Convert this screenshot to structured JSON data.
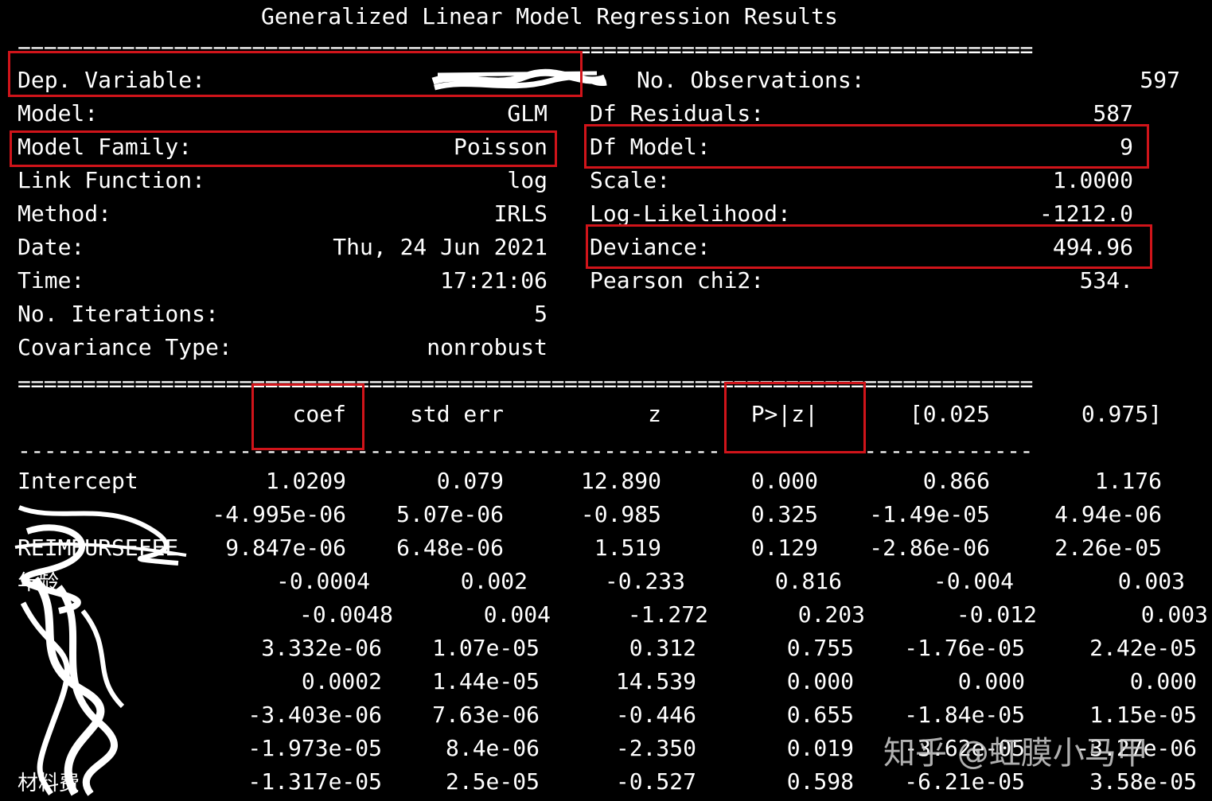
{
  "title": "Generalized Linear Model Regression Results",
  "rules": {
    "eq": "==============================================================================",
    "dash": "------------------------------------------------------------------------------"
  },
  "left": [
    {
      "label": "Dep. Variable:",
      "value": ""
    },
    {
      "label": "Model:",
      "value": "GLM"
    },
    {
      "label": "Model Family:",
      "value": "Poisson"
    },
    {
      "label": "Link Function:",
      "value": "log"
    },
    {
      "label": "Method:",
      "value": "IRLS"
    },
    {
      "label": "Date:",
      "value": "Thu, 24 Jun 2021"
    },
    {
      "label": "Time:",
      "value": "17:21:06"
    },
    {
      "label": "No. Iterations:",
      "value": "5"
    },
    {
      "label": "Covariance Type:",
      "value": "nonrobust"
    }
  ],
  "right": [
    {
      "label": "No. Observations:",
      "value": "597"
    },
    {
      "label": "Df Residuals:",
      "value": "587"
    },
    {
      "label": "Df Model:",
      "value": "9"
    },
    {
      "label": "Scale:",
      "value": "1.0000"
    },
    {
      "label": "Log-Likelihood:",
      "value": "-1212.0"
    },
    {
      "label": "Deviance:",
      "value": "494.96"
    },
    {
      "label": "Pearson chi2:",
      "value": "534."
    }
  ],
  "headers": [
    "coef",
    "std err",
    "z",
    "P>|z|",
    "[0.025",
    "0.975]"
  ],
  "rows": [
    {
      "name": "Intercept",
      "vals": [
        "1.0209",
        "0.079",
        "12.890",
        "0.000",
        "0.866",
        "1.176"
      ]
    },
    {
      "name": "",
      "vals": [
        "-4.995e-06",
        "5.07e-06",
        "-0.985",
        "0.325",
        "-1.49e-05",
        "4.94e-06"
      ]
    },
    {
      "name": "REIMBURSEFEE",
      "vals": [
        "9.847e-06",
        "6.48e-06",
        "1.519",
        "0.129",
        "-2.86e-06",
        "2.26e-05"
      ]
    },
    {
      "name": "年龄",
      "vals": [
        "-0.0004",
        "0.002",
        "-0.233",
        "0.816",
        "-0.004",
        "0.003"
      ]
    },
    {
      "name": "",
      "vals": [
        "-0.0048",
        "0.004",
        "-1.272",
        "0.203",
        "-0.012",
        "0.003"
      ]
    },
    {
      "name": "",
      "vals": [
        "3.332e-06",
        "1.07e-05",
        "0.312",
        "0.755",
        "-1.76e-05",
        "2.42e-05"
      ]
    },
    {
      "name": "",
      "vals": [
        "0.0002",
        "1.44e-05",
        "14.539",
        "0.000",
        "0.000",
        "0.000"
      ]
    },
    {
      "name": "",
      "vals": [
        "-3.403e-06",
        "7.63e-06",
        "-0.446",
        "0.655",
        "-1.84e-05",
        "1.15e-05"
      ]
    },
    {
      "name": "",
      "vals": [
        "-1.973e-05",
        "8.4e-06",
        "-2.350",
        "0.019",
        "-3.62e-05",
        "-3.27e-06"
      ]
    },
    {
      "name": "材料费",
      "vals": [
        "-1.317e-05",
        "2.5e-05",
        "-0.527",
        "0.598",
        "-6.21e-05",
        "3.58e-05"
      ]
    }
  ],
  "watermark": "知乎 @虹膜小马甲",
  "highlight_color": "#d0141a"
}
